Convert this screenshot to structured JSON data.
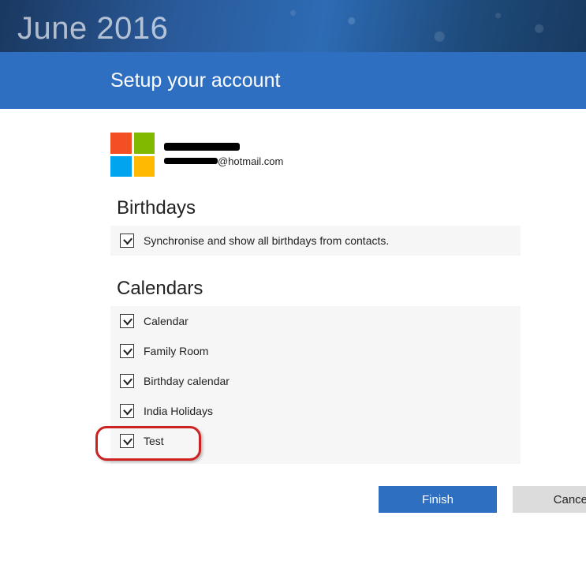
{
  "hero": {
    "title": "June 2016"
  },
  "banner": {
    "title": "Setup your account"
  },
  "account": {
    "name_redacted": "████████",
    "email_domain": "@hotmail.com"
  },
  "sections": {
    "birthdays": {
      "title": "Birthdays",
      "option_label": "Synchronise and show all birthdays from contacts.",
      "option_checked": true
    },
    "calendars": {
      "title": "Calendars",
      "items": [
        {
          "label": "Calendar",
          "checked": true
        },
        {
          "label": "Family Room",
          "checked": true
        },
        {
          "label": "Birthday calendar",
          "checked": true
        },
        {
          "label": "India Holidays",
          "checked": true
        },
        {
          "label": "Test",
          "checked": true,
          "highlighted": true
        }
      ]
    }
  },
  "buttons": {
    "finish": "Finish",
    "cancel": "Cancel"
  }
}
